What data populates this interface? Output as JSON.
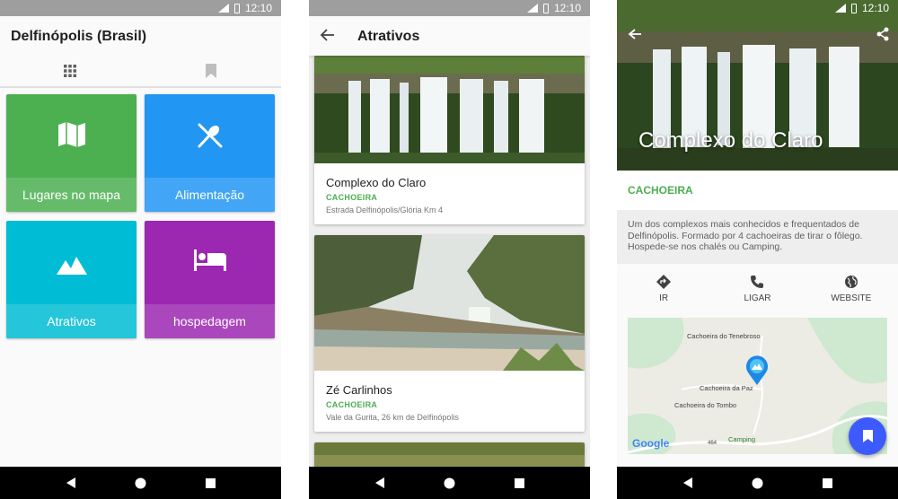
{
  "status": {
    "time": "12:10"
  },
  "screen1": {
    "title": "Delfinópolis (Brasil)",
    "tabs": [
      {
        "icon": "grid-icon"
      },
      {
        "icon": "bookmark-icon"
      }
    ],
    "tiles": [
      {
        "label": "Lugares no mapa",
        "icon": "map-icon",
        "color": "#4caf50",
        "label_bg": "#66bb6a"
      },
      {
        "label": "Alimentação",
        "icon": "restaurant-icon",
        "color": "#2196f3",
        "label_bg": "#42a5f5"
      },
      {
        "label": "Atrativos",
        "icon": "landscape-icon",
        "color": "#00bcd4",
        "label_bg": "#26c6da"
      },
      {
        "label": "hospedagem",
        "icon": "hotel-bed-icon",
        "color": "#9c27b0",
        "label_bg": "#ab47bc"
      }
    ]
  },
  "screen2": {
    "title": "Atrativos",
    "cards": [
      {
        "title": "Complexo do Claro",
        "category": "CACHOEIRA",
        "address": "Estrada Delfinópolis/Glória Km 4"
      },
      {
        "title": "Zé Carlinhos",
        "category": "CACHOEIRA",
        "address": "Vale da Gurita, 26 km de Delfinópolis"
      }
    ]
  },
  "screen3": {
    "title": "Complexo do Claro",
    "category": "CACHOEIRA",
    "description": "Um dos complexos mais conhecidos e frequentados de Delfinópolis. Formado por 4 cachoeiras de tirar o fôlego. Hospede-se nos chalés ou Camping.",
    "actions": [
      {
        "label": "IR",
        "icon": "directions-icon"
      },
      {
        "label": "LIGAR",
        "icon": "phone-icon"
      },
      {
        "label": "WEBSITE",
        "icon": "globe-icon"
      }
    ],
    "map": {
      "labels": {
        "tenebroso": "Cachoeira do Tenebroso",
        "paz": "Cachoeira da Paz",
        "tombo": "Cachoeira do Tombo",
        "camping": "Camping",
        "road": "464"
      },
      "logo": "Google"
    }
  },
  "colors": {
    "accent_green": "#4caf50",
    "fab": "#3d5afe",
    "statusbar": "#9e9e9e"
  }
}
